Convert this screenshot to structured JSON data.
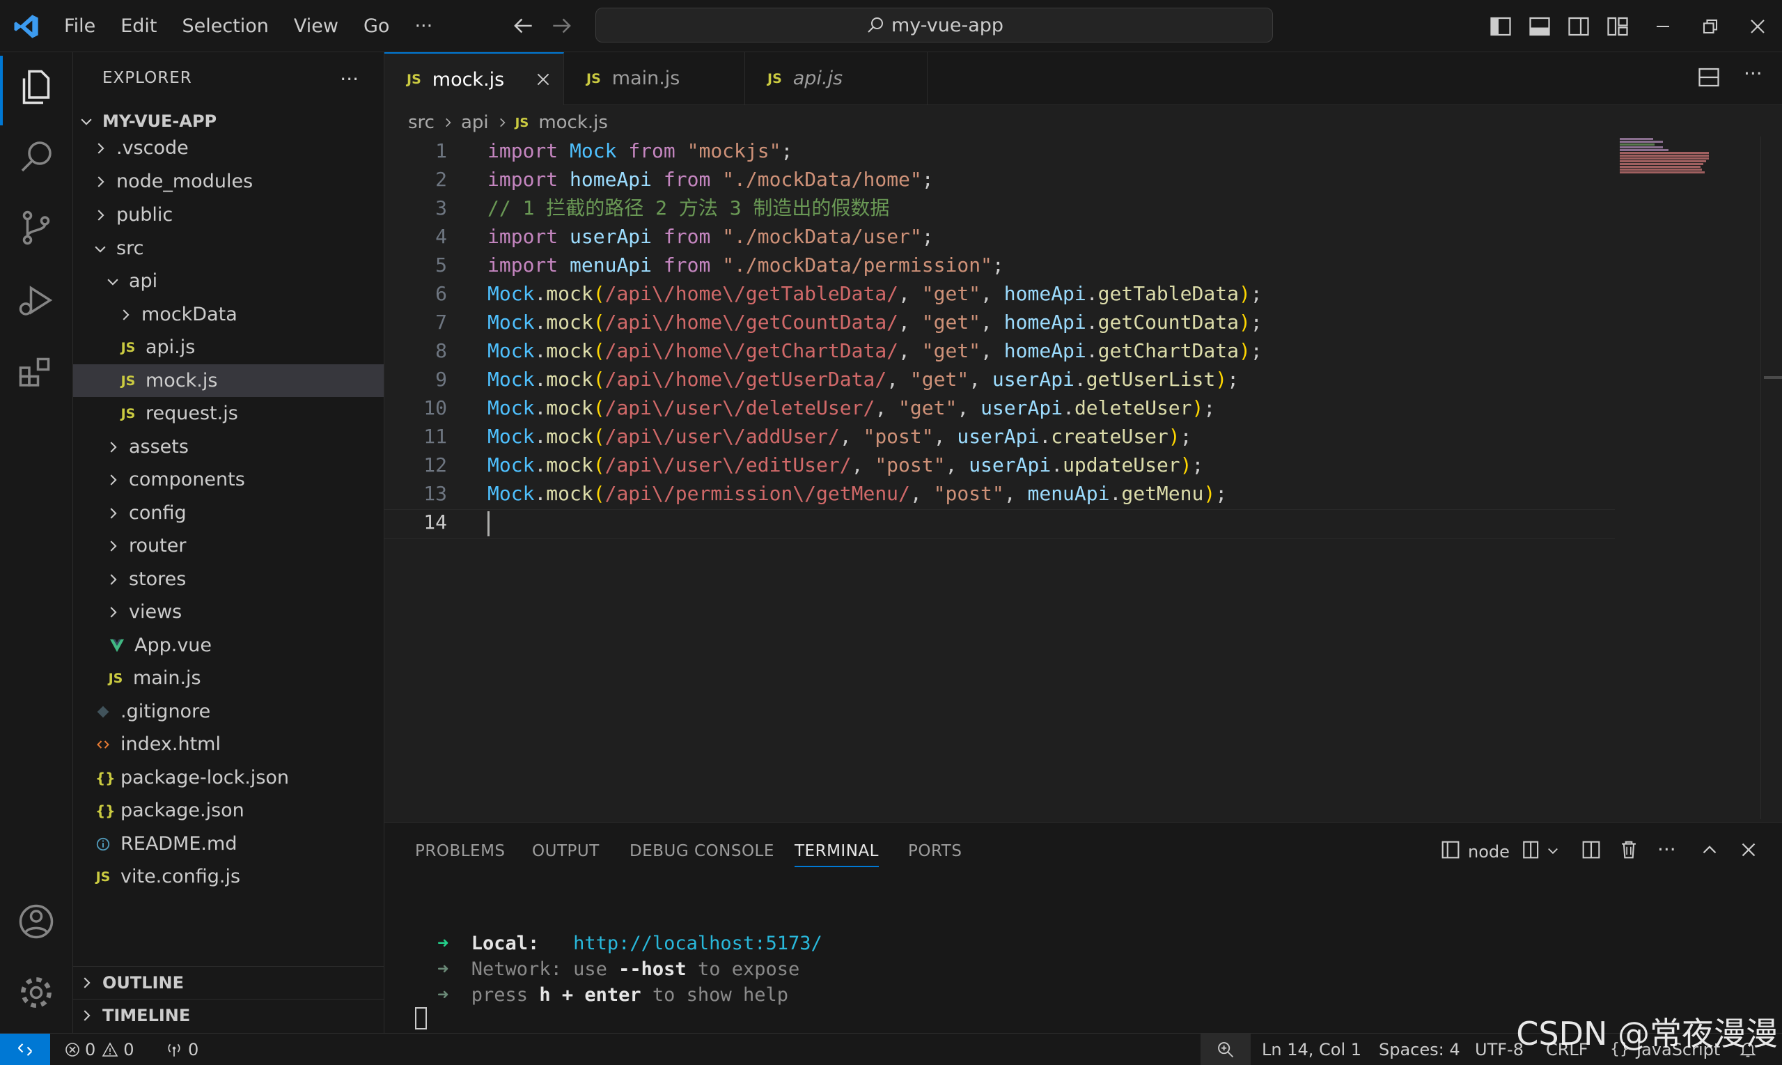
{
  "titlebar": {
    "menus": [
      "File",
      "Edit",
      "Selection",
      "View",
      "Go"
    ],
    "more": "···",
    "search_text": "my-vue-app"
  },
  "explorer": {
    "title": "EXPLORER",
    "more": "···",
    "root": "MY-VUE-APP",
    "items": [
      {
        "label": ".vscode"
      },
      {
        "label": "node_modules"
      },
      {
        "label": "public"
      },
      {
        "label": "src"
      },
      {
        "label": "api"
      },
      {
        "label": "mockData"
      },
      {
        "label": "api.js"
      },
      {
        "label": "mock.js"
      },
      {
        "label": "request.js"
      },
      {
        "label": "assets"
      },
      {
        "label": "components"
      },
      {
        "label": "config"
      },
      {
        "label": "router"
      },
      {
        "label": "stores"
      },
      {
        "label": "views"
      },
      {
        "label": "App.vue"
      },
      {
        "label": "main.js"
      },
      {
        "label": ".gitignore"
      },
      {
        "label": "index.html"
      },
      {
        "label": "package-lock.json"
      },
      {
        "label": "package.json"
      },
      {
        "label": "README.md"
      },
      {
        "label": "vite.config.js"
      }
    ],
    "outline": "OUTLINE",
    "timeline": "TIMELINE"
  },
  "tabs": [
    {
      "label": "mock.js",
      "icon": "JS"
    },
    {
      "label": "main.js",
      "icon": "JS"
    },
    {
      "label": "api.js",
      "icon": "JS"
    }
  ],
  "breadcrumb": {
    "parts": [
      "src",
      "api",
      "mock.js"
    ],
    "icon": "JS"
  },
  "editor": {
    "line_numbers": [
      "1",
      "2",
      "3",
      "4",
      "5",
      "6",
      "7",
      "8",
      "9",
      "10",
      "11",
      "12",
      "13",
      "14"
    ],
    "lines": [
      "import Mock from \"mockjs\";",
      "import homeApi from \"./mockData/home\";",
      "// 1 拦截的路径 2 方法 3 制造出的假数据",
      "import userApi from \"./mockData/user\";",
      "import menuApi from \"./mockData/permission\";",
      "Mock.mock(/api\\/home\\/getTableData/, \"get\", homeApi.getTableData);",
      "Mock.mock(/api\\/home\\/getCountData/, \"get\", homeApi.getCountData);",
      "Mock.mock(/api\\/home\\/getChartData/, \"get\", homeApi.getChartData);",
      "Mock.mock(/api\\/home\\/getUserData/, \"get\", userApi.getUserList);",
      "Mock.mock(/api\\/user\\/deleteUser/, \"get\", userApi.deleteUser);",
      "Mock.mock(/api\\/user\\/addUser/, \"post\", userApi.createUser);",
      "Mock.mock(/api\\/user\\/editUser/, \"post\", userApi.updateUser);",
      "Mock.mock(/api\\/permission\\/getMenu/, \"post\", menuApi.getMenu);",
      ""
    ]
  },
  "panel": {
    "tabs": [
      "PROBLEMS",
      "OUTPUT",
      "DEBUG CONSOLE",
      "TERMINAL",
      "PORTS"
    ],
    "terminal_name": "node",
    "terminal": {
      "arrow": "➜",
      "local_label": "Local:",
      "local_url": "http://localhost:5173/",
      "network_label": "Network:",
      "network_text_1": "use",
      "network_flag": "--host",
      "network_text_2": "to expose",
      "press": "press",
      "key_h": "h + enter",
      "help_text": "to show help"
    }
  },
  "statusbar": {
    "errors": "0",
    "warnings": "0",
    "ports": "0",
    "position": "Ln 14, Col 1",
    "spaces": "Spaces: 4",
    "encoding": "UTF-8",
    "eol": "CRLF",
    "language": "JavaScript"
  },
  "watermark": "CSDN @常夜漫漫",
  "colors": {
    "accent": "#0078d4",
    "keyword": "#c586c0",
    "string": "#ce9178",
    "regex": "#d16969",
    "comment": "#6a9955",
    "js_icon": "#cbcb41",
    "vue_icon": "#41b883"
  }
}
